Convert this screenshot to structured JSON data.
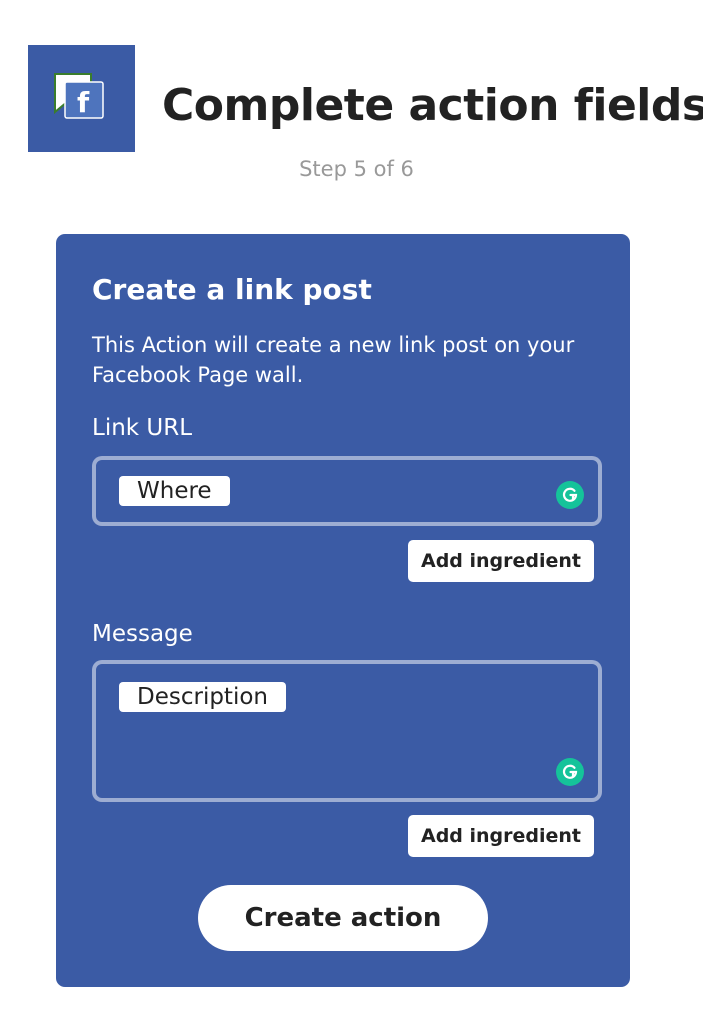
{
  "header": {
    "service_icon": "facebook-pages-icon",
    "title": "Complete action fields",
    "step": "Step 5 of 6"
  },
  "action_card": {
    "title": "Create a link post",
    "description": "This Action will create a new link post on your Facebook Page wall.",
    "fields": [
      {
        "label": "Link URL",
        "ingredient": "Where",
        "add_ingredient_label": "Add ingredient"
      },
      {
        "label": "Message",
        "ingredient": "Description",
        "add_ingredient_label": "Add ingredient"
      }
    ],
    "submit_label": "Create action"
  },
  "colors": {
    "card_background": "#3b5ba5",
    "grammarly": "#15c39a",
    "title_text": "#222222",
    "step_text": "#999999"
  }
}
